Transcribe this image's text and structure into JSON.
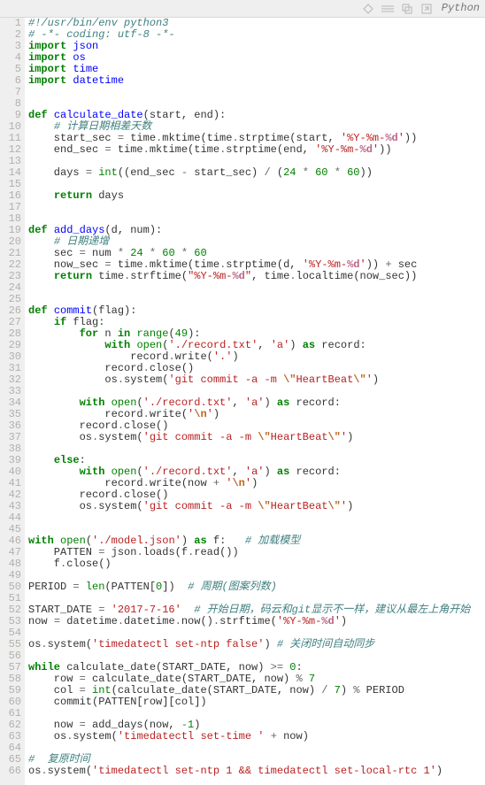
{
  "toolbar": {
    "language_label": "Python"
  },
  "code_lines": [
    [
      {
        "c": "cm",
        "t": "#!/usr/bin/env python3"
      }
    ],
    [
      {
        "c": "cm",
        "t": "# -*- coding: utf-8 -*-"
      }
    ],
    [
      {
        "c": "kw",
        "t": "import"
      },
      {
        "t": " "
      },
      {
        "c": "nm",
        "t": "json"
      }
    ],
    [
      {
        "c": "kw",
        "t": "import"
      },
      {
        "t": " "
      },
      {
        "c": "nm",
        "t": "os"
      }
    ],
    [
      {
        "c": "kw",
        "t": "import"
      },
      {
        "t": " "
      },
      {
        "c": "nm",
        "t": "time"
      }
    ],
    [
      {
        "c": "kw",
        "t": "import"
      },
      {
        "t": " "
      },
      {
        "c": "nm",
        "t": "datetime"
      }
    ],
    [],
    [],
    [
      {
        "c": "kw",
        "t": "def"
      },
      {
        "t": " "
      },
      {
        "c": "nm",
        "t": "calculate_date"
      },
      {
        "t": "(start, end):"
      }
    ],
    [
      {
        "t": "    "
      },
      {
        "c": "cm",
        "t": "# 计算日期相差天数"
      }
    ],
    [
      {
        "t": "    start_sec "
      },
      {
        "c": "op",
        "t": "="
      },
      {
        "t": " time"
      },
      {
        "c": "op",
        "t": "."
      },
      {
        "t": "mktime(time"
      },
      {
        "c": "op",
        "t": "."
      },
      {
        "t": "strptime(start, "
      },
      {
        "c": "st",
        "t": "'%Y-%m-"
      },
      {
        "c": "si",
        "t": "%d"
      },
      {
        "c": "st",
        "t": "'"
      },
      {
        "t": "))"
      }
    ],
    [
      {
        "t": "    end_sec "
      },
      {
        "c": "op",
        "t": "="
      },
      {
        "t": " time"
      },
      {
        "c": "op",
        "t": "."
      },
      {
        "t": "mktime(time"
      },
      {
        "c": "op",
        "t": "."
      },
      {
        "t": "strptime(end, "
      },
      {
        "c": "st",
        "t": "'%Y-%m-"
      },
      {
        "c": "si",
        "t": "%d"
      },
      {
        "c": "st",
        "t": "'"
      },
      {
        "t": "))"
      }
    ],
    [],
    [
      {
        "t": "    days "
      },
      {
        "c": "op",
        "t": "="
      },
      {
        "t": " "
      },
      {
        "c": "bn",
        "t": "int"
      },
      {
        "t": "((end_sec "
      },
      {
        "c": "op",
        "t": "-"
      },
      {
        "t": " start_sec) "
      },
      {
        "c": "op",
        "t": "/"
      },
      {
        "t": " ("
      },
      {
        "c": "num",
        "t": "24"
      },
      {
        "t": " "
      },
      {
        "c": "op",
        "t": "*"
      },
      {
        "t": " "
      },
      {
        "c": "num",
        "t": "60"
      },
      {
        "t": " "
      },
      {
        "c": "op",
        "t": "*"
      },
      {
        "t": " "
      },
      {
        "c": "num",
        "t": "60"
      },
      {
        "t": "))"
      }
    ],
    [],
    [
      {
        "t": "    "
      },
      {
        "c": "kw",
        "t": "return"
      },
      {
        "t": " days"
      }
    ],
    [],
    [],
    [
      {
        "c": "kw",
        "t": "def"
      },
      {
        "t": " "
      },
      {
        "c": "nm",
        "t": "add_days"
      },
      {
        "t": "(d, num):"
      }
    ],
    [
      {
        "t": "    "
      },
      {
        "c": "cm",
        "t": "# 日期递增"
      }
    ],
    [
      {
        "t": "    sec "
      },
      {
        "c": "op",
        "t": "="
      },
      {
        "t": " num "
      },
      {
        "c": "op",
        "t": "*"
      },
      {
        "t": " "
      },
      {
        "c": "num",
        "t": "24"
      },
      {
        "t": " "
      },
      {
        "c": "op",
        "t": "*"
      },
      {
        "t": " "
      },
      {
        "c": "num",
        "t": "60"
      },
      {
        "t": " "
      },
      {
        "c": "op",
        "t": "*"
      },
      {
        "t": " "
      },
      {
        "c": "num",
        "t": "60"
      }
    ],
    [
      {
        "t": "    now_sec "
      },
      {
        "c": "op",
        "t": "="
      },
      {
        "t": " time"
      },
      {
        "c": "op",
        "t": "."
      },
      {
        "t": "mktime(time"
      },
      {
        "c": "op",
        "t": "."
      },
      {
        "t": "strptime(d, "
      },
      {
        "c": "st",
        "t": "'%Y-%m-"
      },
      {
        "c": "si",
        "t": "%d"
      },
      {
        "c": "st",
        "t": "'"
      },
      {
        "t": ")) "
      },
      {
        "c": "op",
        "t": "+"
      },
      {
        "t": " sec"
      }
    ],
    [
      {
        "t": "    "
      },
      {
        "c": "kw",
        "t": "return"
      },
      {
        "t": " time"
      },
      {
        "c": "op",
        "t": "."
      },
      {
        "t": "strftime("
      },
      {
        "c": "st",
        "t": "\"%Y-%m-"
      },
      {
        "c": "si",
        "t": "%d"
      },
      {
        "c": "st",
        "t": "\""
      },
      {
        "t": ", time"
      },
      {
        "c": "op",
        "t": "."
      },
      {
        "t": "localtime(now_sec))"
      }
    ],
    [],
    [],
    [
      {
        "c": "kw",
        "t": "def"
      },
      {
        "t": " "
      },
      {
        "c": "nm",
        "t": "commit"
      },
      {
        "t": "(flag):"
      }
    ],
    [
      {
        "t": "    "
      },
      {
        "c": "kw",
        "t": "if"
      },
      {
        "t": " flag:"
      }
    ],
    [
      {
        "t": "        "
      },
      {
        "c": "kw",
        "t": "for"
      },
      {
        "t": " n "
      },
      {
        "c": "kw",
        "t": "in"
      },
      {
        "t": " "
      },
      {
        "c": "bn",
        "t": "range"
      },
      {
        "t": "("
      },
      {
        "c": "num",
        "t": "49"
      },
      {
        "t": "):"
      }
    ],
    [
      {
        "t": "            "
      },
      {
        "c": "kw",
        "t": "with"
      },
      {
        "t": " "
      },
      {
        "c": "bn",
        "t": "open"
      },
      {
        "t": "("
      },
      {
        "c": "st",
        "t": "'./record.txt'"
      },
      {
        "t": ", "
      },
      {
        "c": "st",
        "t": "'a'"
      },
      {
        "t": ") "
      },
      {
        "c": "kw",
        "t": "as"
      },
      {
        "t": " record:"
      }
    ],
    [
      {
        "t": "                record"
      },
      {
        "c": "op",
        "t": "."
      },
      {
        "t": "write("
      },
      {
        "c": "st",
        "t": "'.'"
      },
      {
        "t": ")"
      }
    ],
    [
      {
        "t": "            record"
      },
      {
        "c": "op",
        "t": "."
      },
      {
        "t": "close()"
      }
    ],
    [
      {
        "t": "            os"
      },
      {
        "c": "op",
        "t": "."
      },
      {
        "t": "system("
      },
      {
        "c": "st",
        "t": "'git commit -a -m "
      },
      {
        "c": "se",
        "t": "\\\""
      },
      {
        "c": "st",
        "t": "HeartBeat"
      },
      {
        "c": "se",
        "t": "\\\""
      },
      {
        "c": "st",
        "t": "'"
      },
      {
        "t": ")"
      }
    ],
    [],
    [
      {
        "t": "        "
      },
      {
        "c": "kw",
        "t": "with"
      },
      {
        "t": " "
      },
      {
        "c": "bn",
        "t": "open"
      },
      {
        "t": "("
      },
      {
        "c": "st",
        "t": "'./record.txt'"
      },
      {
        "t": ", "
      },
      {
        "c": "st",
        "t": "'a'"
      },
      {
        "t": ") "
      },
      {
        "c": "kw",
        "t": "as"
      },
      {
        "t": " record:"
      }
    ],
    [
      {
        "t": "            record"
      },
      {
        "c": "op",
        "t": "."
      },
      {
        "t": "write("
      },
      {
        "c": "st",
        "t": "'"
      },
      {
        "c": "se",
        "t": "\\n"
      },
      {
        "c": "st",
        "t": "'"
      },
      {
        "t": ")"
      }
    ],
    [
      {
        "t": "        record"
      },
      {
        "c": "op",
        "t": "."
      },
      {
        "t": "close()"
      }
    ],
    [
      {
        "t": "        os"
      },
      {
        "c": "op",
        "t": "."
      },
      {
        "t": "system("
      },
      {
        "c": "st",
        "t": "'git commit -a -m "
      },
      {
        "c": "se",
        "t": "\\\""
      },
      {
        "c": "st",
        "t": "HeartBeat"
      },
      {
        "c": "se",
        "t": "\\\""
      },
      {
        "c": "st",
        "t": "'"
      },
      {
        "t": ")"
      }
    ],
    [],
    [
      {
        "t": "    "
      },
      {
        "c": "kw",
        "t": "else"
      },
      {
        "t": ":"
      }
    ],
    [
      {
        "t": "        "
      },
      {
        "c": "kw",
        "t": "with"
      },
      {
        "t": " "
      },
      {
        "c": "bn",
        "t": "open"
      },
      {
        "t": "("
      },
      {
        "c": "st",
        "t": "'./record.txt'"
      },
      {
        "t": ", "
      },
      {
        "c": "st",
        "t": "'a'"
      },
      {
        "t": ") "
      },
      {
        "c": "kw",
        "t": "as"
      },
      {
        "t": " record:"
      }
    ],
    [
      {
        "t": "            record"
      },
      {
        "c": "op",
        "t": "."
      },
      {
        "t": "write(now "
      },
      {
        "c": "op",
        "t": "+"
      },
      {
        "t": " "
      },
      {
        "c": "st",
        "t": "'"
      },
      {
        "c": "se",
        "t": "\\n"
      },
      {
        "c": "st",
        "t": "'"
      },
      {
        "t": ")"
      }
    ],
    [
      {
        "t": "        record"
      },
      {
        "c": "op",
        "t": "."
      },
      {
        "t": "close()"
      }
    ],
    [
      {
        "t": "        os"
      },
      {
        "c": "op",
        "t": "."
      },
      {
        "t": "system("
      },
      {
        "c": "st",
        "t": "'git commit -a -m "
      },
      {
        "c": "se",
        "t": "\\\""
      },
      {
        "c": "st",
        "t": "HeartBeat"
      },
      {
        "c": "se",
        "t": "\\\""
      },
      {
        "c": "st",
        "t": "'"
      },
      {
        "t": ")"
      }
    ],
    [],
    [],
    [
      {
        "c": "kw",
        "t": "with"
      },
      {
        "t": " "
      },
      {
        "c": "bn",
        "t": "open"
      },
      {
        "t": "("
      },
      {
        "c": "st",
        "t": "'./model.json'"
      },
      {
        "t": ") "
      },
      {
        "c": "kw",
        "t": "as"
      },
      {
        "t": " f:   "
      },
      {
        "c": "cm",
        "t": "# 加载模型"
      }
    ],
    [
      {
        "t": "    PATTEN "
      },
      {
        "c": "op",
        "t": "="
      },
      {
        "t": " json"
      },
      {
        "c": "op",
        "t": "."
      },
      {
        "t": "loads(f"
      },
      {
        "c": "op",
        "t": "."
      },
      {
        "t": "read())"
      }
    ],
    [
      {
        "t": "    f"
      },
      {
        "c": "op",
        "t": "."
      },
      {
        "t": "close()"
      }
    ],
    [],
    [
      {
        "t": "PERIOD "
      },
      {
        "c": "op",
        "t": "="
      },
      {
        "t": " "
      },
      {
        "c": "bn",
        "t": "len"
      },
      {
        "t": "(PATTEN["
      },
      {
        "c": "num",
        "t": "0"
      },
      {
        "t": "])  "
      },
      {
        "c": "cm",
        "t": "# 周期(图案列数)"
      }
    ],
    [],
    [
      {
        "t": "START_DATE "
      },
      {
        "c": "op",
        "t": "="
      },
      {
        "t": " "
      },
      {
        "c": "st",
        "t": "'2017-7-16'"
      },
      {
        "t": "  "
      },
      {
        "c": "cm",
        "t": "# 开始日期，码云和git显示不一样，建议从最左上角开始"
      }
    ],
    [
      {
        "t": "now "
      },
      {
        "c": "op",
        "t": "="
      },
      {
        "t": " datetime"
      },
      {
        "c": "op",
        "t": "."
      },
      {
        "t": "datetime"
      },
      {
        "c": "op",
        "t": "."
      },
      {
        "t": "now()"
      },
      {
        "c": "op",
        "t": "."
      },
      {
        "t": "strftime("
      },
      {
        "c": "st",
        "t": "'%Y-%m-"
      },
      {
        "c": "si",
        "t": "%d"
      },
      {
        "c": "st",
        "t": "'"
      },
      {
        "t": ")"
      }
    ],
    [],
    [
      {
        "t": "os"
      },
      {
        "c": "op",
        "t": "."
      },
      {
        "t": "system("
      },
      {
        "c": "st",
        "t": "'timedatectl set-ntp false'"
      },
      {
        "t": ") "
      },
      {
        "c": "cm",
        "t": "# 关闭时间自动同步"
      }
    ],
    [],
    [
      {
        "c": "kw",
        "t": "while"
      },
      {
        "t": " calculate_date(START_DATE, now) "
      },
      {
        "c": "op",
        "t": ">="
      },
      {
        "t": " "
      },
      {
        "c": "num",
        "t": "0"
      },
      {
        "t": ":"
      }
    ],
    [
      {
        "t": "    row "
      },
      {
        "c": "op",
        "t": "="
      },
      {
        "t": " calculate_date(START_DATE, now) "
      },
      {
        "c": "op",
        "t": "%"
      },
      {
        "t": " "
      },
      {
        "c": "num",
        "t": "7"
      }
    ],
    [
      {
        "t": "    col "
      },
      {
        "c": "op",
        "t": "="
      },
      {
        "t": " "
      },
      {
        "c": "bn",
        "t": "int"
      },
      {
        "t": "(calculate_date(START_DATE, now) "
      },
      {
        "c": "op",
        "t": "/"
      },
      {
        "t": " "
      },
      {
        "c": "num",
        "t": "7"
      },
      {
        "t": ") "
      },
      {
        "c": "op",
        "t": "%"
      },
      {
        "t": " PERIOD"
      }
    ],
    [
      {
        "t": "    commit(PATTEN[row][col])"
      }
    ],
    [],
    [
      {
        "t": "    now "
      },
      {
        "c": "op",
        "t": "="
      },
      {
        "t": " add_days(now, "
      },
      {
        "c": "op",
        "t": "-"
      },
      {
        "c": "num",
        "t": "1"
      },
      {
        "t": ")"
      }
    ],
    [
      {
        "t": "    os"
      },
      {
        "c": "op",
        "t": "."
      },
      {
        "t": "system("
      },
      {
        "c": "st",
        "t": "'timedatectl set-time '"
      },
      {
        "t": " "
      },
      {
        "c": "op",
        "t": "+"
      },
      {
        "t": " now)"
      }
    ],
    [],
    [
      {
        "c": "cm",
        "t": "#  复原时间"
      }
    ],
    [
      {
        "t": "os"
      },
      {
        "c": "op",
        "t": "."
      },
      {
        "t": "system("
      },
      {
        "c": "st",
        "t": "'timedatectl set-ntp 1 && timedatectl set-local-rtc 1'"
      },
      {
        "t": ")"
      }
    ]
  ]
}
